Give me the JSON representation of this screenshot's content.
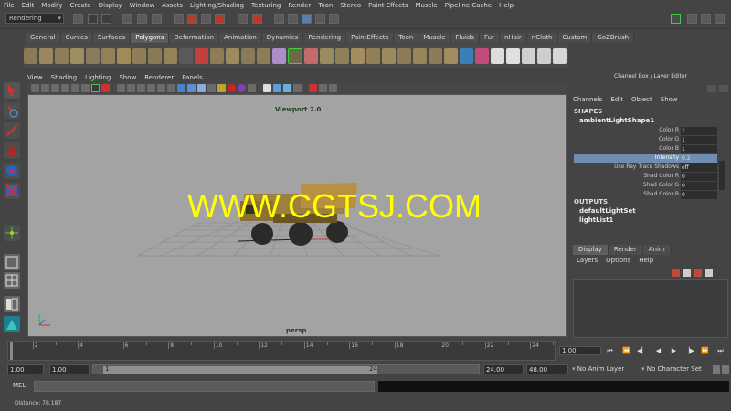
{
  "menubar": [
    "File",
    "Edit",
    "Modify",
    "Create",
    "Display",
    "Window",
    "Assets",
    "Lighting/Shading",
    "Texturing",
    "Render",
    "Toon",
    "Stereo",
    "Paint Effects",
    "Muscle",
    "Pipeline Cache",
    "Help"
  ],
  "statusline": {
    "mode": "Rendering"
  },
  "shelf_tabs": [
    "General",
    "Curves",
    "Surfaces",
    "Polygons",
    "Deformation",
    "Animation",
    "Dynamics",
    "Rendering",
    "PaintEffects",
    "Toon",
    "Muscle",
    "Fluids",
    "Fur",
    "nHair",
    "nCloth",
    "Custom",
    "GoZBrush"
  ],
  "shelf_active_tab": "Polygons",
  "viewport": {
    "menus": [
      "View",
      "Shading",
      "Lighting",
      "Show",
      "Renderer",
      "Panels"
    ],
    "title": "Viewport 2.0",
    "camera": "persp"
  },
  "watermark": "WWW.CGTSJ.COM",
  "channel_box": {
    "title": "Channel Box / Layer Editor",
    "menus": [
      "Channels",
      "Edit",
      "Object",
      "Show"
    ],
    "shapes_header": "SHAPES",
    "shape_name": "ambientLightShape1",
    "attributes": [
      {
        "name": "Color R",
        "value": "1"
      },
      {
        "name": "Color G",
        "value": "1"
      },
      {
        "name": "Color B",
        "value": "1"
      },
      {
        "name": "Intensity",
        "value": "0.2"
      },
      {
        "name": "Use Ray Trace Shadows",
        "value": "off"
      },
      {
        "name": "Shad Color R",
        "value": "0"
      },
      {
        "name": "Shad Color G",
        "value": "0"
      },
      {
        "name": "Shad Color B",
        "value": "0"
      }
    ],
    "outputs_header": "OUTPUTS",
    "outputs": [
      "defaultLightSet",
      "lightList1"
    ]
  },
  "layer_editor": {
    "tabs": [
      "Display",
      "Render",
      "Anim"
    ],
    "menus": [
      "Layers",
      "Options",
      "Help"
    ]
  },
  "time_slider": {
    "ticks": [
      "2",
      "4",
      "6",
      "8",
      "10",
      "12",
      "14",
      "16",
      "18",
      "20",
      "22",
      "24"
    ],
    "current_frame": "1.00"
  },
  "range_slider": {
    "start": "1.00",
    "playback_start": "1.00",
    "handle_start": "1",
    "handle_end": "24",
    "playback_end": "24.00",
    "end": "48.00",
    "anim_layer": "No Anim Layer",
    "character_set": "No Character Set"
  },
  "command_line": {
    "label": "MEL"
  },
  "help_line": "Distance:  78.187",
  "colors": {
    "viewport_bg": "#a3a3a3",
    "highlight": "#6e8db0",
    "watermark": "#ffff00"
  }
}
